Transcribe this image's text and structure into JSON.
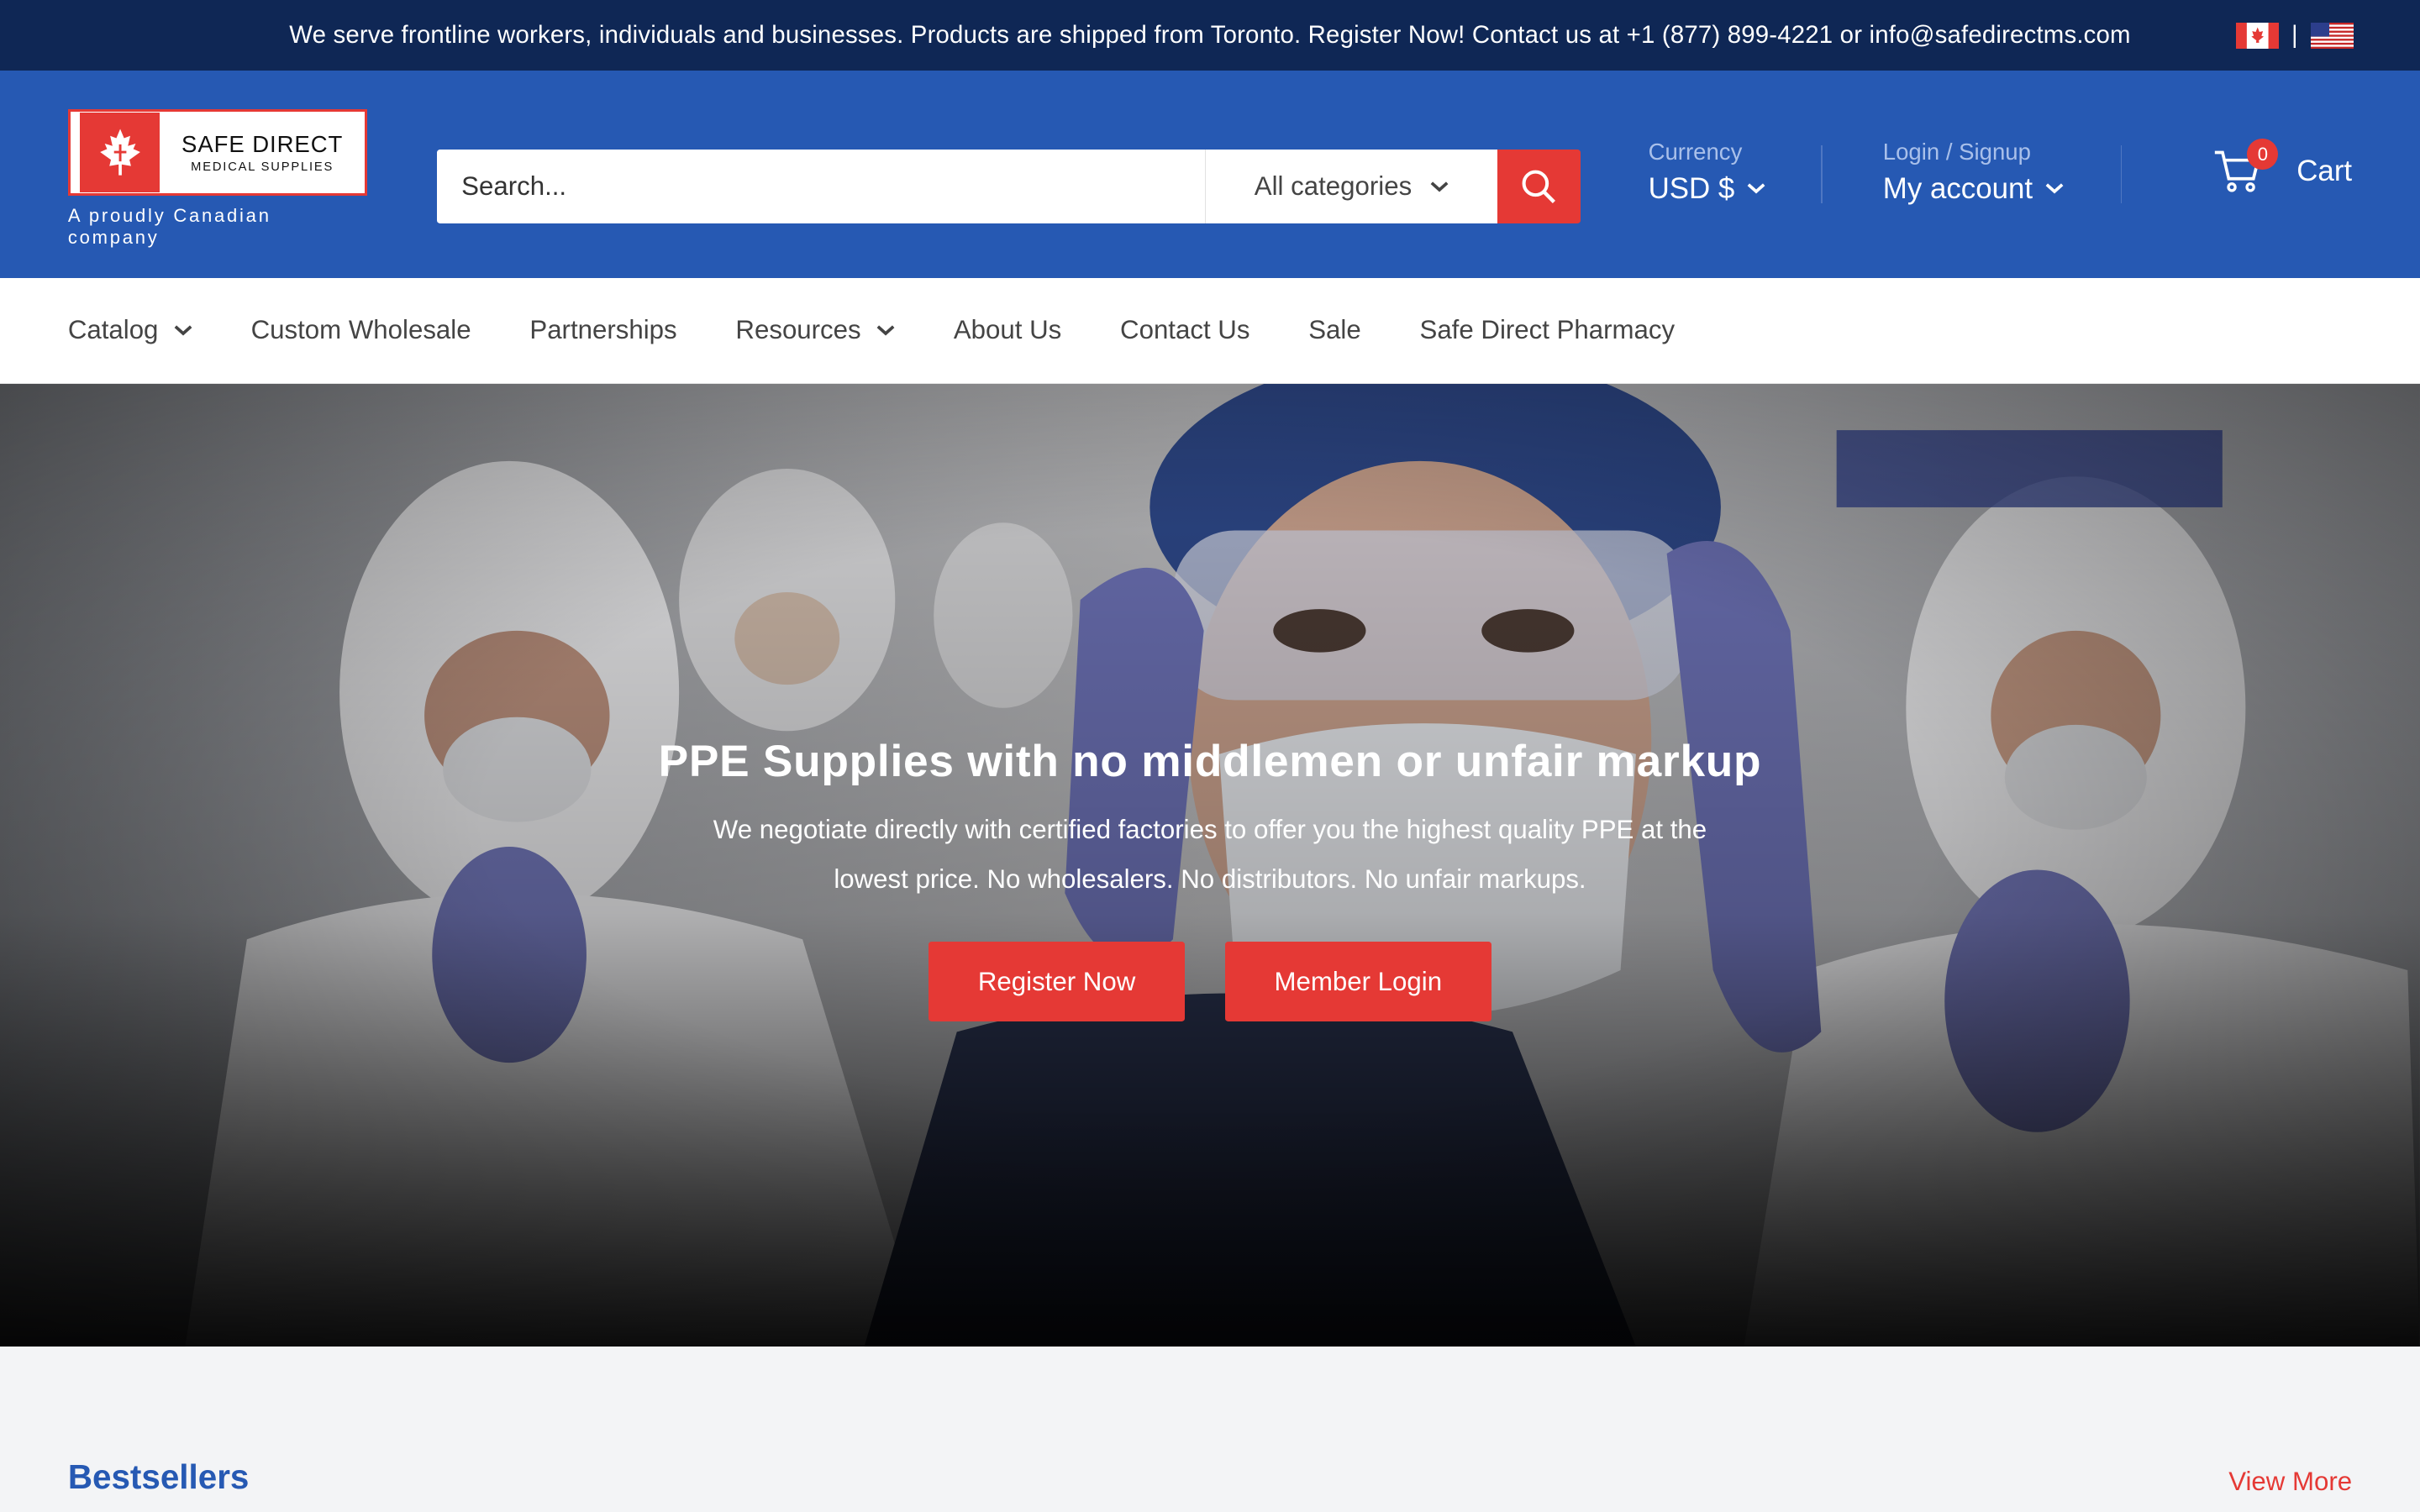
{
  "announcement": {
    "text": "We serve frontline workers, individuals and businesses. Products are shipped from Toronto. Register Now! Contact us at +1 (877) 899-4221 or info@safedirectms.com",
    "separator": "|"
  },
  "logo": {
    "line1": "SAFE DIRECT",
    "line2": "MEDICAL SUPPLIES",
    "tagline": "A proudly Canadian company"
  },
  "search": {
    "placeholder": "Search...",
    "category": "All categories"
  },
  "currency": {
    "label": "Currency",
    "value": "USD $"
  },
  "account": {
    "label": "Login / Signup",
    "value": "My account"
  },
  "cart": {
    "label": "Cart",
    "count": "0"
  },
  "nav": {
    "items": [
      {
        "label": "Catalog"
      },
      {
        "label": "Custom Wholesale"
      },
      {
        "label": "Partnerships"
      },
      {
        "label": "Resources"
      },
      {
        "label": "About Us"
      },
      {
        "label": "Contact Us"
      },
      {
        "label": "Sale"
      },
      {
        "label": "Safe Direct Pharmacy"
      }
    ]
  },
  "hero": {
    "title": "PPE Supplies with no middlemen or unfair markup",
    "subtitle": "We negotiate directly with certified factories to offer you the highest quality PPE at the lowest price. No wholesalers. No distributors. No unfair markups.",
    "primary_button": "Register Now",
    "secondary_button": "Member Login"
  },
  "bestsellers": {
    "title": "Bestsellers",
    "view_more": "View More"
  },
  "colors": {
    "header_blue": "#2659b3",
    "announce_navy": "#0f2755",
    "accent_red": "#e53935"
  }
}
